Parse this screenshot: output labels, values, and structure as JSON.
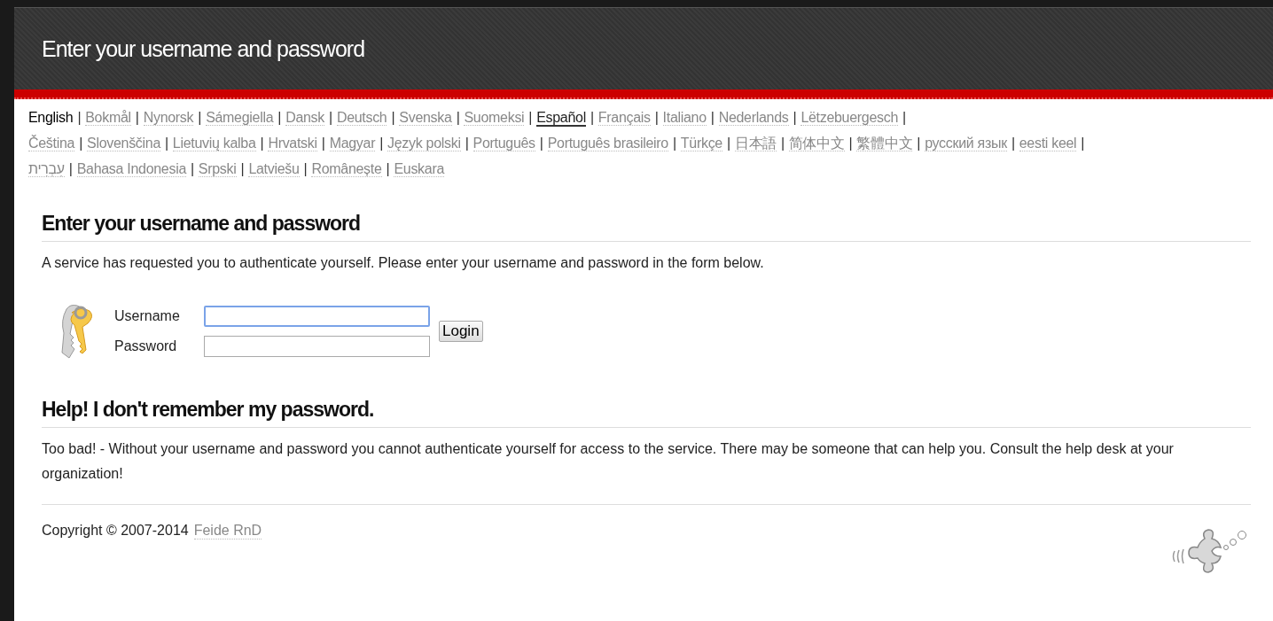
{
  "header": {
    "title": "Enter your username and password"
  },
  "languages": [
    {
      "label": "English",
      "selected": true,
      "hover": false
    },
    {
      "label": "Bokmål",
      "selected": false,
      "hover": false
    },
    {
      "label": "Nynorsk",
      "selected": false,
      "hover": false
    },
    {
      "label": "Sámegiella",
      "selected": false,
      "hover": false
    },
    {
      "label": "Dansk",
      "selected": false,
      "hover": false
    },
    {
      "label": "Deutsch",
      "selected": false,
      "hover": false
    },
    {
      "label": "Svenska",
      "selected": false,
      "hover": false
    },
    {
      "label": "Suomeksi",
      "selected": false,
      "hover": false
    },
    {
      "label": "Español",
      "selected": false,
      "hover": true
    },
    {
      "label": "Français",
      "selected": false,
      "hover": false
    },
    {
      "label": "Italiano",
      "selected": false,
      "hover": false
    },
    {
      "label": "Nederlands",
      "selected": false,
      "hover": false
    },
    {
      "label": "Lëtzebuergesch",
      "selected": false,
      "hover": false
    },
    {
      "label": "Čeština",
      "selected": false,
      "hover": false
    },
    {
      "label": "Slovenščina",
      "selected": false,
      "hover": false
    },
    {
      "label": "Lietuvių kalba",
      "selected": false,
      "hover": false
    },
    {
      "label": "Hrvatski",
      "selected": false,
      "hover": false
    },
    {
      "label": "Magyar",
      "selected": false,
      "hover": false
    },
    {
      "label": "Język polski",
      "selected": false,
      "hover": false
    },
    {
      "label": "Português",
      "selected": false,
      "hover": false
    },
    {
      "label": "Português brasileiro",
      "selected": false,
      "hover": false
    },
    {
      "label": "Türkçe",
      "selected": false,
      "hover": false
    },
    {
      "label": "日本語",
      "selected": false,
      "hover": false
    },
    {
      "label": "简体中文",
      "selected": false,
      "hover": false
    },
    {
      "label": "繁體中文",
      "selected": false,
      "hover": false
    },
    {
      "label": "русский язык",
      "selected": false,
      "hover": false
    },
    {
      "label": "eesti keel",
      "selected": false,
      "hover": false
    },
    {
      "label": "עִבְרִית",
      "selected": false,
      "hover": false
    },
    {
      "label": "Bahasa Indonesia",
      "selected": false,
      "hover": false
    },
    {
      "label": "Srpski",
      "selected": false,
      "hover": false
    },
    {
      "label": "Latviešu",
      "selected": false,
      "hover": false
    },
    {
      "label": "Românește",
      "selected": false,
      "hover": false
    },
    {
      "label": "Euskara",
      "selected": false,
      "hover": false
    }
  ],
  "separator": "|",
  "login": {
    "heading": "Enter your username and password",
    "intro": "A service has requested you to authenticate yourself. Please enter your username and password in the form below.",
    "fields": [
      {
        "label": "Username",
        "focused": true
      },
      {
        "label": "Password",
        "focused": false
      }
    ],
    "button": "Login"
  },
  "help": {
    "heading": "Help! I don't remember my password.",
    "text": "Too bad! - Without your username and password you cannot authenticate yourself for access to the service. There may be someone that can help you. Consult the help desk at your organization!"
  },
  "footer": {
    "copyright": "Copyright © 2007-2014",
    "link": "Feide RnD"
  }
}
